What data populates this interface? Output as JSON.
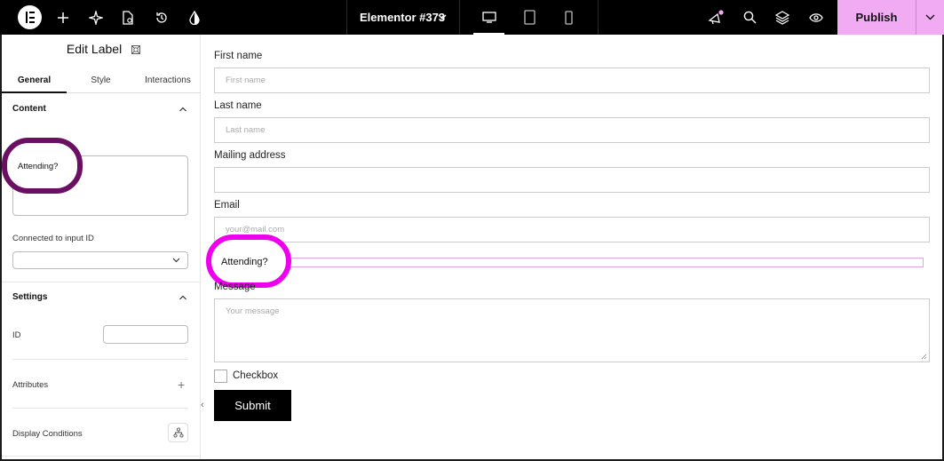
{
  "topbar": {
    "document_title": "Elementor #373",
    "publish_label": "Publish"
  },
  "panel": {
    "title": "Edit Label",
    "tabs": [
      "General",
      "Style",
      "Interactions"
    ],
    "content_heading": "Content",
    "label_text_value": "Attending?",
    "connected_label": "Connected to input ID",
    "settings_heading": "Settings",
    "id_label": "ID",
    "attributes_label": "Attributes",
    "display_conditions_label": "Display Conditions"
  },
  "form": {
    "first_name_label": "First name",
    "first_name_placeholder": "First name",
    "last_name_label": "Last name",
    "last_name_placeholder": "Last name",
    "mailing_label": "Mailing address",
    "email_label": "Email",
    "email_placeholder": "your@mail.com",
    "attending_label": "Attending?",
    "message_label": "Message",
    "message_placeholder": "Your message",
    "checkbox_label": "Checkbox",
    "submit_label": "Submit"
  },
  "colors": {
    "publish_bg": "#f0abf2",
    "highlight_ring_panel": "#6b0f63",
    "highlight_ring_canvas": "#ee00ee"
  }
}
